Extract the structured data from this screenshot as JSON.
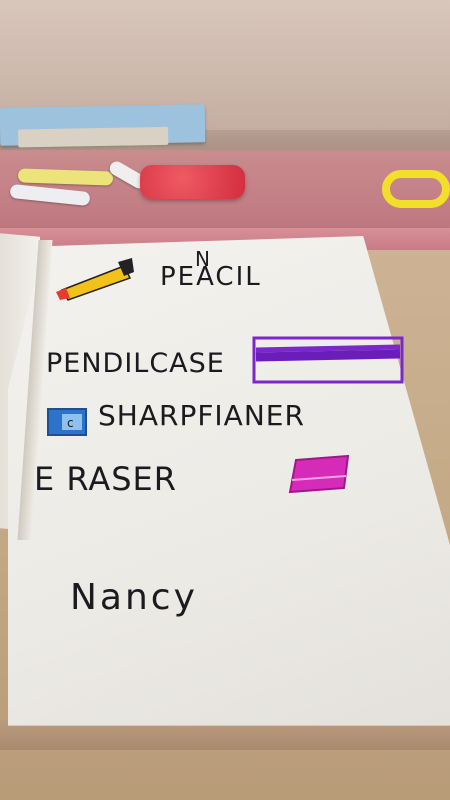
{
  "notebook": {
    "words": {
      "pencil": "PEACIL",
      "pencil_correction": "N",
      "pencilcase": "PENDILCASE",
      "sharpener": "SHARPFIANER",
      "eraser": "E RASER",
      "name": "Nancy"
    }
  },
  "colors": {
    "pencil_yellow": "#f3c21a",
    "pencil_red_tip": "#e8392f",
    "case_purple": "#7a28c9",
    "sharpener_blue": "#2c73c9",
    "eraser_magenta": "#d62bb8",
    "ink": "#1b1a1f"
  }
}
